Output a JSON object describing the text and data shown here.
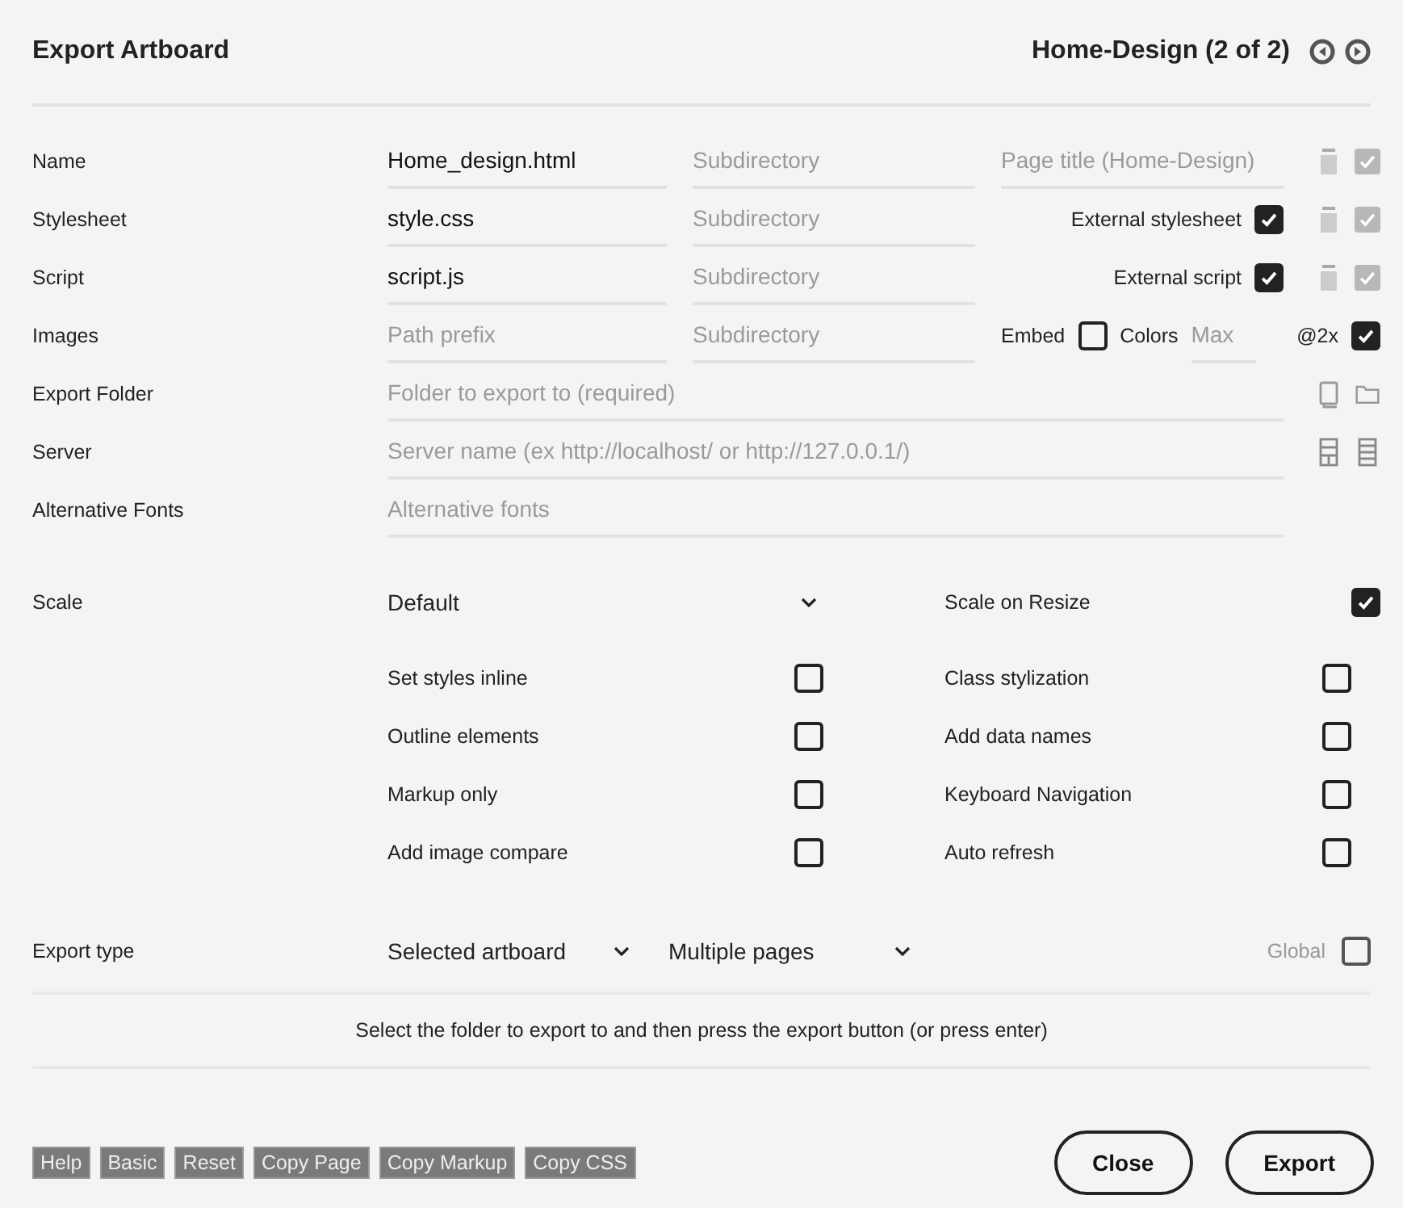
{
  "window": {
    "title": "Export Artboard",
    "artboard": "Home-Design (2 of 2)"
  },
  "rows": [
    {
      "kind": "file",
      "label": "Name",
      "file": {
        "value": "Home_design.html"
      },
      "subdirectory": {
        "placeholder": "Subdirectory"
      },
      "extra": {
        "kind": "field",
        "placeholder": "Page title (Home-Design)"
      },
      "side": {
        "checked": true
      }
    },
    {
      "kind": "file",
      "label": "Stylesheet",
      "file": {
        "value": "style.css"
      },
      "subdirectory": {
        "placeholder": "Subdirectory"
      },
      "extra": {
        "kind": "check",
        "label": "External stylesheet",
        "checked": true
      },
      "side": {
        "checked": true
      }
    },
    {
      "kind": "file",
      "label": "Script",
      "file": {
        "value": "script.js"
      },
      "subdirectory": {
        "placeholder": "Subdirectory"
      },
      "extra": {
        "kind": "check",
        "label": "External script",
        "checked": true
      },
      "side": {
        "checked": true
      }
    },
    {
      "kind": "file",
      "label": "Images",
      "file": {
        "placeholder": "Path prefix"
      },
      "subdirectory": {
        "placeholder": "Subdirectory"
      },
      "extra": {
        "kind": "images",
        "embed": {
          "label": "Embed",
          "checked": false
        },
        "colors": {
          "label": "Colors",
          "placeholder": "Max"
        },
        "retina": {
          "label": "@2x",
          "checked": true
        }
      }
    },
    {
      "kind": "folder",
      "label": "Export Folder",
      "placeholder": "Folder to export to (required)"
    },
    {
      "kind": "server",
      "label": "Server",
      "placeholder": "Server name (ex http://localhost/ or http://127.0.0.1/)"
    },
    {
      "kind": "fonts",
      "label": "Alternative Fonts",
      "placeholder": "Alternative fonts"
    }
  ],
  "scale": {
    "label": "Scale",
    "value": "Default",
    "resize": {
      "label": "Scale on Resize",
      "checked": true
    }
  },
  "options": [
    {
      "label": "Set styles inline",
      "checked": false
    },
    {
      "label": "Class stylization",
      "checked": false
    },
    {
      "label": "Outline elements",
      "checked": false
    },
    {
      "label": "Add data names",
      "checked": false
    },
    {
      "label": "Markup only",
      "checked": false
    },
    {
      "label": "Keyboard Navigation",
      "checked": false
    },
    {
      "label": "Add image compare",
      "checked": false
    },
    {
      "label": "Auto refresh",
      "checked": false
    }
  ],
  "export_type": {
    "label": "Export type",
    "selection": "Selected artboard",
    "pages": "Multiple pages",
    "global": {
      "label": "Global",
      "checked": false,
      "disabled": true
    }
  },
  "message": "Select the folder to export to and then press the export button (or press enter)",
  "footer_buttons": [
    "Help",
    "Basic",
    "Reset",
    "Copy Page",
    "Copy Markup",
    "Copy CSS"
  ],
  "actions": [
    "Close",
    "Export"
  ]
}
